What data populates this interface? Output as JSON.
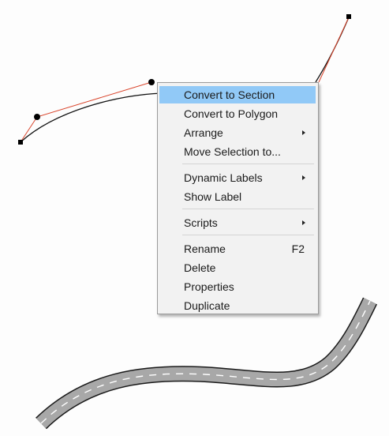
{
  "canvas": {
    "colors": {
      "bezier_handle": "#d9442b",
      "curve": "#111111",
      "road_fill": "#a8a8a8",
      "road_edge": "#1a1a1a",
      "lane_dash": "#ffffff",
      "menu_highlight": "#91c9f7"
    }
  },
  "context_menu": {
    "items": [
      {
        "label": "Convert to Section",
        "shortcut": "",
        "submenu": false,
        "highlighted": true
      },
      {
        "label": "Convert to Polygon",
        "shortcut": "",
        "submenu": false
      },
      {
        "label": "Arrange",
        "shortcut": "",
        "submenu": true
      },
      {
        "label": "Move Selection to...",
        "shortcut": "",
        "submenu": false
      },
      {
        "label": "Dynamic Labels",
        "shortcut": "",
        "submenu": true
      },
      {
        "label": "Show Label",
        "shortcut": "",
        "submenu": false
      },
      {
        "label": "Scripts",
        "shortcut": "",
        "submenu": true
      },
      {
        "label": "Rename",
        "shortcut": "F2",
        "submenu": false
      },
      {
        "label": "Delete",
        "shortcut": "",
        "submenu": false
      },
      {
        "label": "Properties",
        "shortcut": "",
        "submenu": false
      },
      {
        "label": "Duplicate",
        "shortcut": "",
        "submenu": false
      }
    ]
  }
}
